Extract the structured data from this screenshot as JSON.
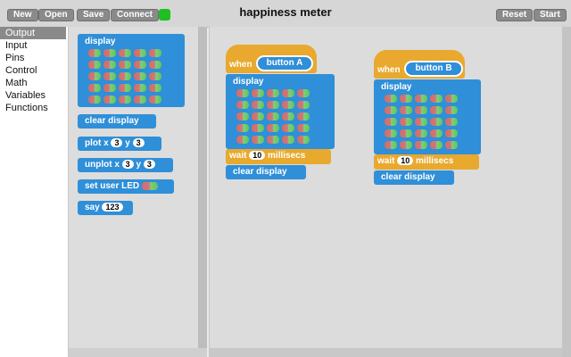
{
  "toolbar": {
    "new": "New",
    "open": "Open",
    "save": "Save",
    "connect": "Connect",
    "title": "happiness meter",
    "reset": "Reset",
    "start": "Start",
    "status_color": "#1fc01f"
  },
  "categories": [
    "Output",
    "Input",
    "Pins",
    "Control",
    "Math",
    "Variables",
    "Functions"
  ],
  "palette": {
    "display": "display",
    "clear_display": "clear display",
    "plot_label": "plot x",
    "plot_x": "3",
    "plot_y_label": "y",
    "plot_y": "3",
    "unplot_label": "unplot x",
    "unplot_x": "3",
    "unplot_y_label": "y",
    "unplot_y": "3",
    "set_user_led": "set user LED",
    "say": "say",
    "say_value": "123"
  },
  "scripts": [
    {
      "when": "when",
      "button": "button A",
      "display": "display",
      "wait": "wait",
      "wait_value": "10",
      "millisecs": "millisecs",
      "clear": "clear display"
    },
    {
      "when": "when",
      "button": "button B",
      "display": "display",
      "wait": "wait",
      "wait_value": "10",
      "millisecs": "millisecs",
      "clear": "clear display"
    }
  ],
  "colors": {
    "motion": "#2f8fd8",
    "event": "#e8a92e",
    "led_on": "#d76a6a",
    "led_green": "#5ec55e"
  }
}
